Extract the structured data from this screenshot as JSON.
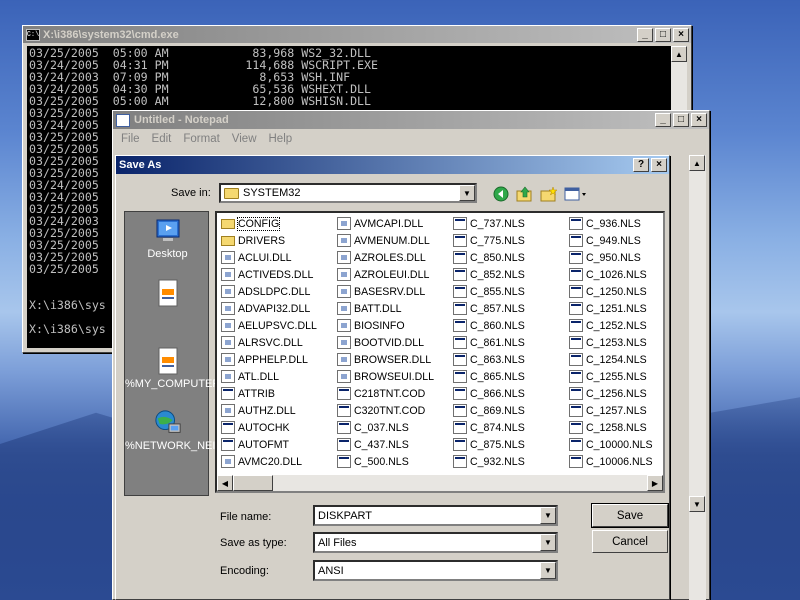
{
  "cmd": {
    "title": "X:\\i386\\system32\\cmd.exe",
    "lines": [
      "03/25/2005  05:00 AM            83,968 WS2_32.DLL",
      "03/24/2005  04:31 PM           114,688 WSCRIPT.EXE",
      "03/24/2003  07:09 PM             8,653 WSH.INF",
      "03/24/2005  04:30 PM            65,536 WSHEXT.DLL",
      "03/25/2005  05:00 AM            12,800 WSHISN.DLL",
      "03/25/2005",
      "03/24/2005",
      "03/25/2005",
      "03/25/2005",
      "03/25/2005",
      "03/25/2005",
      "03/24/2005",
      "03/24/2005",
      "03/25/2005",
      "03/24/2003",
      "03/25/2005",
      "03/25/2005",
      "03/25/2005",
      "03/25/2005",
      "",
      "",
      "X:\\i386\\sys",
      "",
      "X:\\i386\\sys"
    ]
  },
  "notepad": {
    "title": "Untitled - Notepad",
    "menu": [
      "File",
      "Edit",
      "Format",
      "View",
      "Help"
    ]
  },
  "saveas": {
    "title": "Save As",
    "save_in_label": "Save in:",
    "save_in_value": "SYSTEM32",
    "places": [
      "Desktop",
      "",
      "%MY_COMPUTER%",
      "%NETWORK_NEIGHBORH..."
    ],
    "columns": [
      [
        {
          "name": "CONFIG",
          "type": "folder",
          "selected": true
        },
        {
          "name": "DRIVERS",
          "type": "folder"
        },
        {
          "name": "ACLUI.DLL",
          "type": "dll"
        },
        {
          "name": "ACTIVEDS.DLL",
          "type": "dll"
        },
        {
          "name": "ADSLDPC.DLL",
          "type": "dll"
        },
        {
          "name": "ADVAPI32.DLL",
          "type": "dll"
        },
        {
          "name": "AELUPSVC.DLL",
          "type": "dll"
        },
        {
          "name": "ALRSVC.DLL",
          "type": "dll"
        },
        {
          "name": "APPHELP.DLL",
          "type": "dll"
        },
        {
          "name": "ATL.DLL",
          "type": "dll"
        },
        {
          "name": "ATTRIB",
          "type": "nls"
        },
        {
          "name": "AUTHZ.DLL",
          "type": "dll"
        },
        {
          "name": "AUTOCHK",
          "type": "nls"
        },
        {
          "name": "AUTOFMT",
          "type": "nls"
        },
        {
          "name": "AVMC20.DLL",
          "type": "dll"
        }
      ],
      [
        {
          "name": "AVMCAPI.DLL",
          "type": "dll"
        },
        {
          "name": "AVMENUM.DLL",
          "type": "dll"
        },
        {
          "name": "AZROLES.DLL",
          "type": "dll"
        },
        {
          "name": "AZROLEUI.DLL",
          "type": "dll"
        },
        {
          "name": "BASESRV.DLL",
          "type": "dll"
        },
        {
          "name": "BATT.DLL",
          "type": "dll"
        },
        {
          "name": "BIOSINFO",
          "type": "dll"
        },
        {
          "name": "BOOTVID.DLL",
          "type": "dll"
        },
        {
          "name": "BROWSER.DLL",
          "type": "dll"
        },
        {
          "name": "BROWSEUI.DLL",
          "type": "dll"
        },
        {
          "name": "C218TNT.COD",
          "type": "nls"
        },
        {
          "name": "C320TNT.COD",
          "type": "nls"
        },
        {
          "name": "C_037.NLS",
          "type": "nls"
        },
        {
          "name": "C_437.NLS",
          "type": "nls"
        },
        {
          "name": "C_500.NLS",
          "type": "nls"
        }
      ],
      [
        {
          "name": "C_737.NLS",
          "type": "nls"
        },
        {
          "name": "C_775.NLS",
          "type": "nls"
        },
        {
          "name": "C_850.NLS",
          "type": "nls"
        },
        {
          "name": "C_852.NLS",
          "type": "nls"
        },
        {
          "name": "C_855.NLS",
          "type": "nls"
        },
        {
          "name": "C_857.NLS",
          "type": "nls"
        },
        {
          "name": "C_860.NLS",
          "type": "nls"
        },
        {
          "name": "C_861.NLS",
          "type": "nls"
        },
        {
          "name": "C_863.NLS",
          "type": "nls"
        },
        {
          "name": "C_865.NLS",
          "type": "nls"
        },
        {
          "name": "C_866.NLS",
          "type": "nls"
        },
        {
          "name": "C_869.NLS",
          "type": "nls"
        },
        {
          "name": "C_874.NLS",
          "type": "nls"
        },
        {
          "name": "C_875.NLS",
          "type": "nls"
        },
        {
          "name": "C_932.NLS",
          "type": "nls"
        }
      ],
      [
        {
          "name": "C_936.NLS",
          "type": "nls"
        },
        {
          "name": "C_949.NLS",
          "type": "nls"
        },
        {
          "name": "C_950.NLS",
          "type": "nls"
        },
        {
          "name": "C_1026.NLS",
          "type": "nls"
        },
        {
          "name": "C_1250.NLS",
          "type": "nls"
        },
        {
          "name": "C_1251.NLS",
          "type": "nls"
        },
        {
          "name": "C_1252.NLS",
          "type": "nls"
        },
        {
          "name": "C_1253.NLS",
          "type": "nls"
        },
        {
          "name": "C_1254.NLS",
          "type": "nls"
        },
        {
          "name": "C_1255.NLS",
          "type": "nls"
        },
        {
          "name": "C_1256.NLS",
          "type": "nls"
        },
        {
          "name": "C_1257.NLS",
          "type": "nls"
        },
        {
          "name": "C_1258.NLS",
          "type": "nls"
        },
        {
          "name": "C_10000.NLS",
          "type": "nls"
        },
        {
          "name": "C_10006.NLS",
          "type": "nls"
        }
      ]
    ],
    "file_name_label": "File name:",
    "file_name_value": "DISKPART",
    "save_type_label": "Save as type:",
    "save_type_value": "All Files",
    "encoding_label": "Encoding:",
    "encoding_value": "ANSI",
    "save_button": "Save",
    "cancel_button": "Cancel"
  },
  "icons": {
    "back": "back-arrow-icon",
    "up": "up-folder-icon",
    "new_folder": "new-folder-icon",
    "views": "views-menu-icon"
  }
}
